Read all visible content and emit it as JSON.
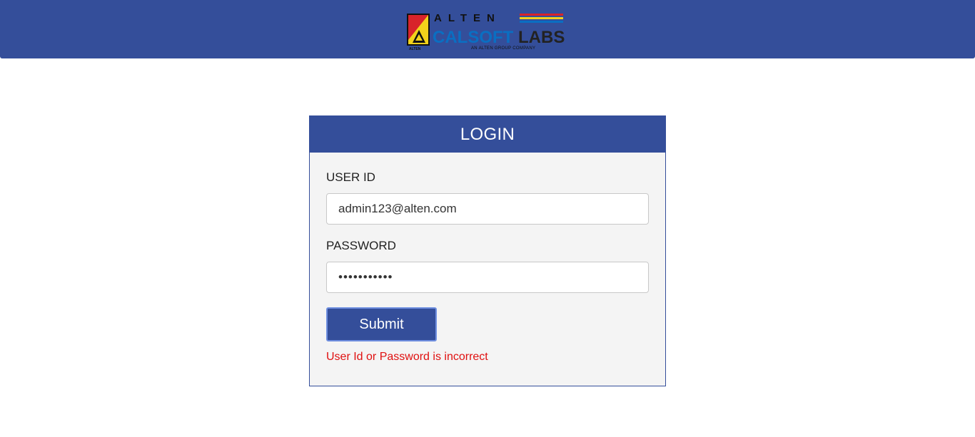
{
  "brand": {
    "logo_top": "ALTEN",
    "logo_main_left": "CALSOFT",
    "logo_main_right": "LABS",
    "logo_tagline": "AN ALTEN GROUP COMPANY",
    "logo_small": "ALTEN",
    "header_color": "#344e9a",
    "logo_blue": "#0a6fc2",
    "logo_dark": "#333333",
    "stripe_red": "#d8232a",
    "stripe_yellow": "#f2d21b"
  },
  "login": {
    "title": "LOGIN",
    "user_label": "USER ID",
    "user_value": "admin123@alten.com",
    "password_label": "PASSWORD",
    "password_value": "•••••••••••",
    "submit_label": "Submit",
    "error_text": "User Id or Password is incorrect",
    "error_color": "#e01010"
  }
}
